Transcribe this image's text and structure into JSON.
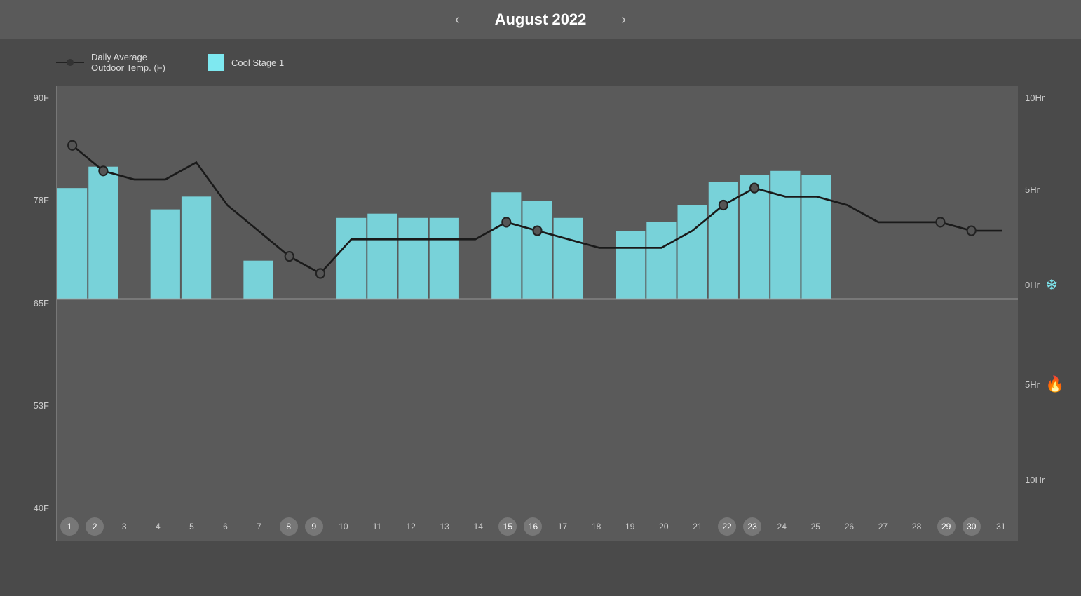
{
  "header": {
    "title": "August 2022",
    "prev_label": "‹",
    "next_label": "›"
  },
  "legend": {
    "line_label": "Daily Average\nOutdoor Temp. (F)",
    "cool_stage_label": "Cool Stage 1"
  },
  "chart": {
    "y_axis_left": [
      "90F",
      "78F",
      "65F",
      "53F",
      "40F"
    ],
    "y_axis_right": [
      "10Hr",
      "5Hr",
      "0Hr",
      "5Hr",
      "10Hr"
    ],
    "x_labels": [
      {
        "day": "1",
        "highlighted": true
      },
      {
        "day": "2",
        "highlighted": true
      },
      {
        "day": "3",
        "highlighted": false
      },
      {
        "day": "4",
        "highlighted": false
      },
      {
        "day": "5",
        "highlighted": false
      },
      {
        "day": "6",
        "highlighted": false
      },
      {
        "day": "7",
        "highlighted": false
      },
      {
        "day": "8",
        "highlighted": true
      },
      {
        "day": "9",
        "highlighted": true
      },
      {
        "day": "10",
        "highlighted": false
      },
      {
        "day": "11",
        "highlighted": false
      },
      {
        "day": "12",
        "highlighted": false
      },
      {
        "day": "13",
        "highlighted": false
      },
      {
        "day": "14",
        "highlighted": false
      },
      {
        "day": "15",
        "highlighted": true
      },
      {
        "day": "16",
        "highlighted": true
      },
      {
        "day": "17",
        "highlighted": false
      },
      {
        "day": "18",
        "highlighted": false
      },
      {
        "day": "19",
        "highlighted": false
      },
      {
        "day": "20",
        "highlighted": false
      },
      {
        "day": "21",
        "highlighted": false
      },
      {
        "day": "22",
        "highlighted": true
      },
      {
        "day": "23",
        "highlighted": true
      },
      {
        "day": "24",
        "highlighted": false
      },
      {
        "day": "25",
        "highlighted": false
      },
      {
        "day": "26",
        "highlighted": false
      },
      {
        "day": "27",
        "highlighted": false
      },
      {
        "day": "28",
        "highlighted": false
      },
      {
        "day": "29",
        "highlighted": true
      },
      {
        "day": "30",
        "highlighted": true
      },
      {
        "day": "31",
        "highlighted": false
      }
    ],
    "bars": [
      {
        "day": 1,
        "height_pct": 0.52
      },
      {
        "day": 2,
        "height_pct": 0.62
      },
      {
        "day": 3,
        "height_pct": 0.0
      },
      {
        "day": 4,
        "height_pct": 0.42
      },
      {
        "day": 5,
        "height_pct": 0.48
      },
      {
        "day": 6,
        "height_pct": 0.0
      },
      {
        "day": 7,
        "height_pct": 0.18
      },
      {
        "day": 8,
        "height_pct": 0.0
      },
      {
        "day": 9,
        "height_pct": 0.0
      },
      {
        "day": 10,
        "height_pct": 0.38
      },
      {
        "day": 11,
        "height_pct": 0.4
      },
      {
        "day": 12,
        "height_pct": 0.38
      },
      {
        "day": 13,
        "height_pct": 0.38
      },
      {
        "day": 14,
        "height_pct": 0.0
      },
      {
        "day": 15,
        "height_pct": 0.5
      },
      {
        "day": 16,
        "height_pct": 0.46
      },
      {
        "day": 17,
        "height_pct": 0.38
      },
      {
        "day": 18,
        "height_pct": 0.0
      },
      {
        "day": 19,
        "height_pct": 0.32
      },
      {
        "day": 20,
        "height_pct": 0.36
      },
      {
        "day": 21,
        "height_pct": 0.44
      },
      {
        "day": 22,
        "height_pct": 0.55
      },
      {
        "day": 23,
        "height_pct": 0.58
      },
      {
        "day": 24,
        "height_pct": 0.6
      },
      {
        "day": 25,
        "height_pct": 0.58
      },
      {
        "day": 26,
        "height_pct": 0.0
      },
      {
        "day": 27,
        "height_pct": 0.0
      },
      {
        "day": 28,
        "height_pct": 0.0
      },
      {
        "day": 29,
        "height_pct": 0.0
      },
      {
        "day": 30,
        "height_pct": 0.0
      },
      {
        "day": 31,
        "height_pct": 0.0
      }
    ],
    "temp_line": [
      83,
      80,
      79,
      79,
      81,
      76,
      73,
      70,
      68,
      72,
      72,
      72,
      72,
      72,
      74,
      73,
      72,
      71,
      71,
      71,
      73,
      76,
      78,
      77,
      77,
      76,
      74,
      74,
      74,
      73,
      73
    ],
    "temp_min": 40,
    "temp_max": 90,
    "accent_color": "#7ee8f0",
    "line_color": "#222222",
    "zero_line_temp": 65
  }
}
